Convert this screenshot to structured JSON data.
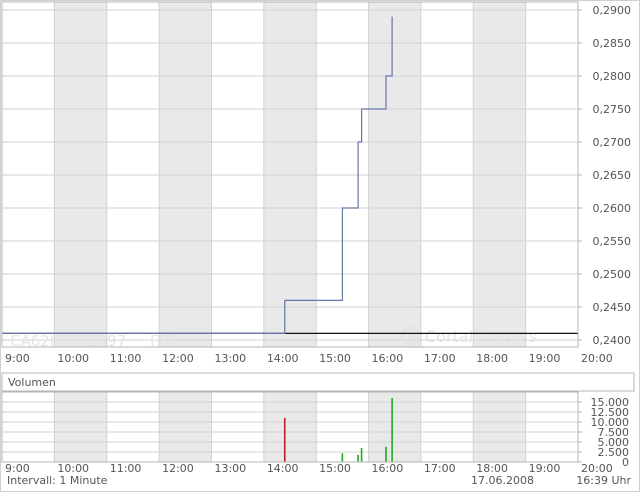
{
  "colors": {
    "band_gray": "#e9e9e9",
    "grid_line": "#d2d2d2",
    "frame": "#b4b4b4",
    "price_line": "#6677a8",
    "prev_close_line": "#111111",
    "volume_up": "#22aa22",
    "volume_down": "#bb2222",
    "text": "#555555",
    "watermark": "#e4e4e4"
  },
  "watermark": {
    "symbol": "CA6289541097",
    "exchange": "FRA",
    "brand": "CortalConsors"
  },
  "footer": {
    "interval": "Intervall: 1 Minute",
    "date": "17.06.2008",
    "time": "16:39 Uhr"
  },
  "chart_data": [
    {
      "type": "line",
      "name": "price",
      "x_ticks": [
        "9:00",
        "10:00",
        "11:00",
        "12:00",
        "13:00",
        "14:00",
        "15:00",
        "16:00",
        "17:00",
        "18:00",
        "19:00",
        "20:00"
      ],
      "x_range": [
        "9:00",
        "20:00"
      ],
      "y_range": [
        0.24,
        0.29
      ],
      "y_ticks": [
        0.24,
        0.245,
        0.25,
        0.255,
        0.26,
        0.265,
        0.27,
        0.275,
        0.28,
        0.285,
        0.29
      ],
      "y_tick_labels": [
        "0,2400",
        "0,2450",
        "0,2500",
        "0,2550",
        "0,2600",
        "0,2650",
        "0,2700",
        "0,2750",
        "0,2800",
        "0,2850",
        "0,2900"
      ],
      "grid": true,
      "alternating_hour_bands": true,
      "previous_close": 0.241,
      "series": [
        {
          "points": [
            [
              "9:00",
              0.241
            ],
            [
              "14:24",
              0.241
            ],
            [
              "14:24",
              0.246
            ],
            [
              "15:30",
              0.246
            ],
            [
              "15:30",
              0.26
            ],
            [
              "15:48",
              0.26
            ],
            [
              "15:48",
              0.27
            ],
            [
              "15:52",
              0.27
            ],
            [
              "15:52",
              0.275
            ],
            [
              "16:20",
              0.275
            ],
            [
              "16:20",
              0.28
            ],
            [
              "16:27",
              0.28
            ],
            [
              "16:27",
              0.289
            ]
          ]
        }
      ]
    },
    {
      "type": "bar",
      "name": "volume",
      "title": "Volumen",
      "x_ticks": [
        "9:00",
        "10:00",
        "11:00",
        "12:00",
        "13:00",
        "14:00",
        "15:00",
        "16:00",
        "17:00",
        "18:00",
        "19:00",
        "20:00"
      ],
      "x_range": [
        "9:00",
        "20:00"
      ],
      "y_range": [
        0,
        17500
      ],
      "y_ticks": [
        0,
        2500,
        5000,
        7500,
        10000,
        12500,
        15000
      ],
      "y_tick_labels": [
        "0",
        "2.500",
        "5.000",
        "7.500",
        "10.000",
        "12.500",
        "15.000"
      ],
      "grid": true,
      "bars": [
        {
          "time": "14:24",
          "value": 11000,
          "direction": "down"
        },
        {
          "time": "15:30",
          "value": 2200,
          "direction": "up"
        },
        {
          "time": "15:48",
          "value": 1800,
          "direction": "up"
        },
        {
          "time": "15:52",
          "value": 3500,
          "direction": "up"
        },
        {
          "time": "16:20",
          "value": 3800,
          "direction": "up"
        },
        {
          "time": "16:27",
          "value": 16000,
          "direction": "up"
        }
      ]
    }
  ]
}
